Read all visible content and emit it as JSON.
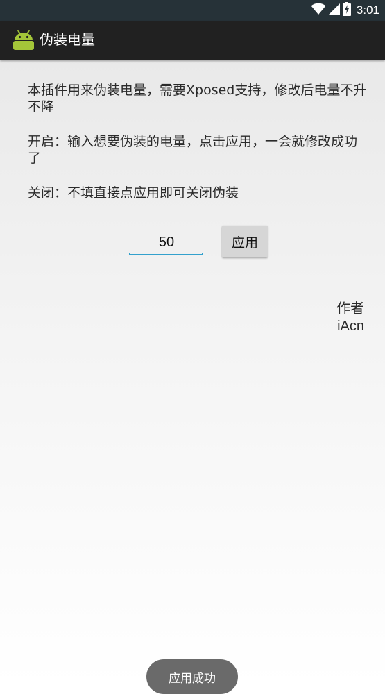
{
  "status_bar": {
    "time": "3:01",
    "icons": [
      "wifi-icon",
      "signal-icon",
      "battery-charging-icon"
    ],
    "background": "#263238"
  },
  "app_bar": {
    "title": "伪装电量",
    "icon": "android-icon",
    "background": "#212121"
  },
  "content": {
    "description": "本插件用来伪装电量，需要Xposed支持，修改后电量不升不降",
    "enable_instructions": "开启：输入想要伪装的电量，点击应用，一会就修改成功了",
    "disable_instructions": "关闭：不填直接点应用即可关闭伪装"
  },
  "battery_input": {
    "value": "50",
    "accent": "#33a1cd"
  },
  "apply_button": {
    "label": "应用"
  },
  "author": {
    "label": "作者",
    "name": "iAcn"
  },
  "toast": {
    "message": "应用成功"
  }
}
